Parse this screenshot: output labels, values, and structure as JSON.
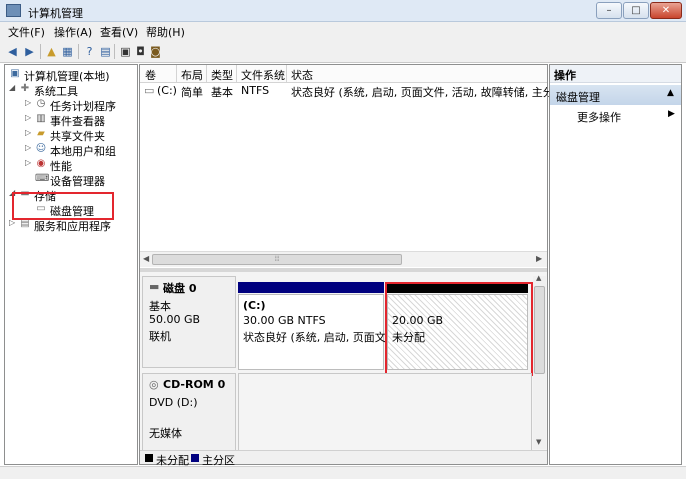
{
  "window": {
    "title": "计算机管理",
    "buttons": {
      "minimize": "–",
      "maximize": "□",
      "close": "✕"
    }
  },
  "menubar": [
    "文件(F)",
    "操作(A)",
    "查看(V)",
    "帮助(H)"
  ],
  "toolbar": {
    "icons": [
      "back-arrow-icon",
      "forward-arrow-icon",
      "up-folder-icon",
      "show-hide-tree-icon",
      "help-icon",
      "properties-icon",
      "refresh-icon",
      "export-icon",
      "settings-icon"
    ]
  },
  "tree": {
    "root": "计算机管理(本地)",
    "system_tools": "系统工具",
    "task_scheduler": "任务计划程序",
    "event_viewer": "事件查看器",
    "shared_folders": "共享文件夹",
    "local_users": "本地用户和组",
    "performance": "性能",
    "device_manager": "设备管理器",
    "storage": "存储",
    "disk_management": "磁盘管理",
    "services_apps": "服务和应用程序"
  },
  "columns": [
    "卷",
    "布局",
    "类型",
    "文件系统",
    "状态"
  ],
  "volumes": [
    {
      "name": "(C:)",
      "layout": "简单",
      "type": "基本",
      "fs": "NTFS",
      "status": "状态良好 (系统, 启动, 页面文件, 活动, 故障转储, 主分区)"
    }
  ],
  "disk0": {
    "title": "磁盘 0",
    "type": "基本",
    "size": "50.00 GB",
    "state": "联机",
    "partitions": [
      {
        "label": "(C:)",
        "size_fs": "30.00 GB NTFS",
        "status": "状态良好 (系统, 启动, 页面文件"
      },
      {
        "size": "20.00 GB",
        "status": "未分配"
      }
    ]
  },
  "cdrom": {
    "title": "CD-ROM 0",
    "type": "DVD (D:)",
    "media": "无媒体"
  },
  "legend": {
    "unallocated": "未分配",
    "primary": "主分区"
  },
  "actions": {
    "header": "操作",
    "section": "磁盘管理",
    "more": "更多操作"
  },
  "colors": {
    "primary_bar": "#00007f",
    "unallocated_bar": "#000000",
    "highlight_red": "#e3262e"
  }
}
